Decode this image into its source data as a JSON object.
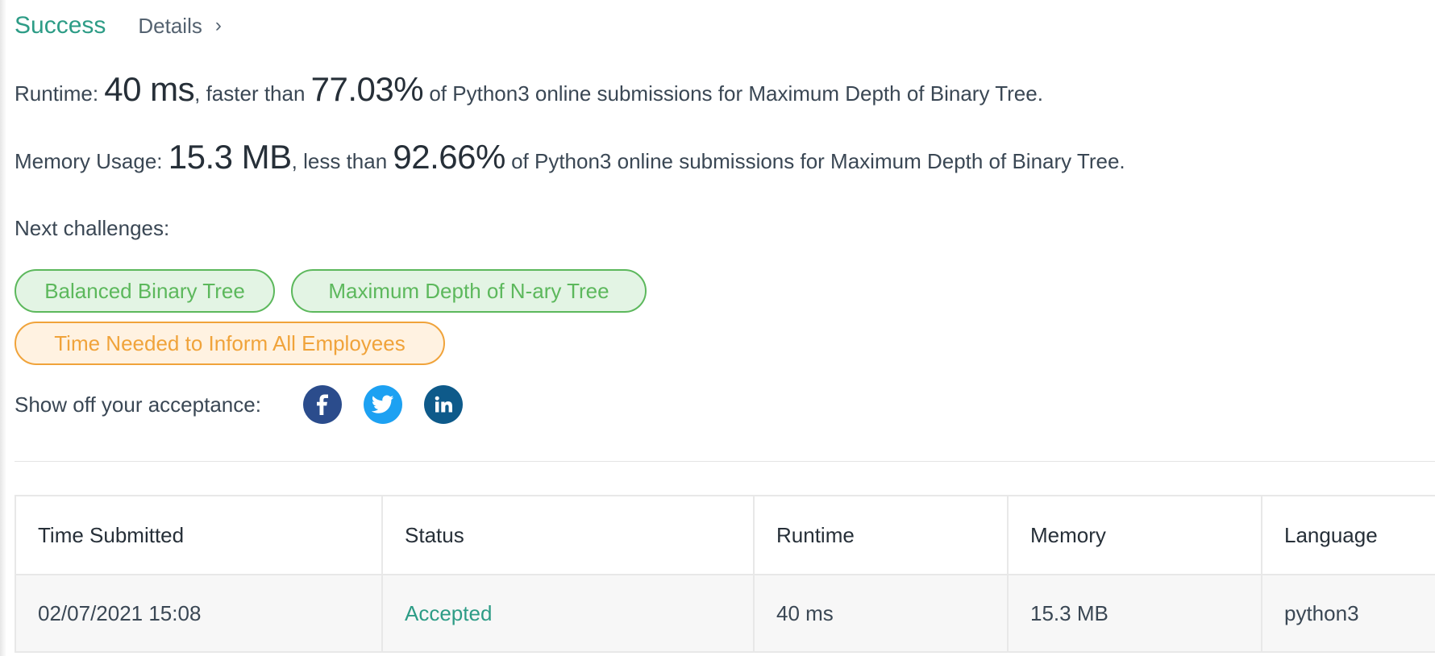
{
  "header": {
    "status": "Success",
    "details_label": "Details",
    "details_chevron": "›"
  },
  "runtime": {
    "label": "Runtime: ",
    "value": "40 ms",
    "comparison": ", faster than ",
    "percent": "77.03%",
    "suffix": " of Python3 online submissions for Maximum Depth of Binary Tree."
  },
  "memory": {
    "label": "Memory Usage: ",
    "value": "15.3 MB",
    "comparison": ", less than ",
    "percent": "92.66%",
    "suffix": " of Python3 online submissions for Maximum Depth of Binary Tree."
  },
  "next_challenges": {
    "label": "Next challenges:",
    "items": [
      {
        "title": "Balanced Binary Tree",
        "difficulty": "easy",
        "color": "#5cb85c"
      },
      {
        "title": "Maximum Depth of N-ary Tree",
        "difficulty": "easy",
        "color": "#5cb85c"
      },
      {
        "title": "Time Needed to Inform All Employees",
        "difficulty": "medium",
        "color": "#f0a33a"
      }
    ]
  },
  "share": {
    "label": "Show off your acceptance:",
    "icons": [
      "facebook-icon",
      "twitter-icon",
      "linkedin-icon"
    ],
    "colors": {
      "facebook": "#2b4c8c",
      "twitter": "#1da1f2",
      "linkedin": "#0e5a8a"
    }
  },
  "submissions": {
    "headers": [
      "Time Submitted",
      "Status",
      "Runtime",
      "Memory",
      "Language"
    ],
    "rows": [
      {
        "time": "02/07/2021 15:08",
        "status": "Accepted",
        "runtime": "40 ms",
        "memory": "15.3 MB",
        "language": "python3"
      }
    ]
  },
  "colors": {
    "accent": "#2d9c86",
    "text": "#3a4754"
  }
}
